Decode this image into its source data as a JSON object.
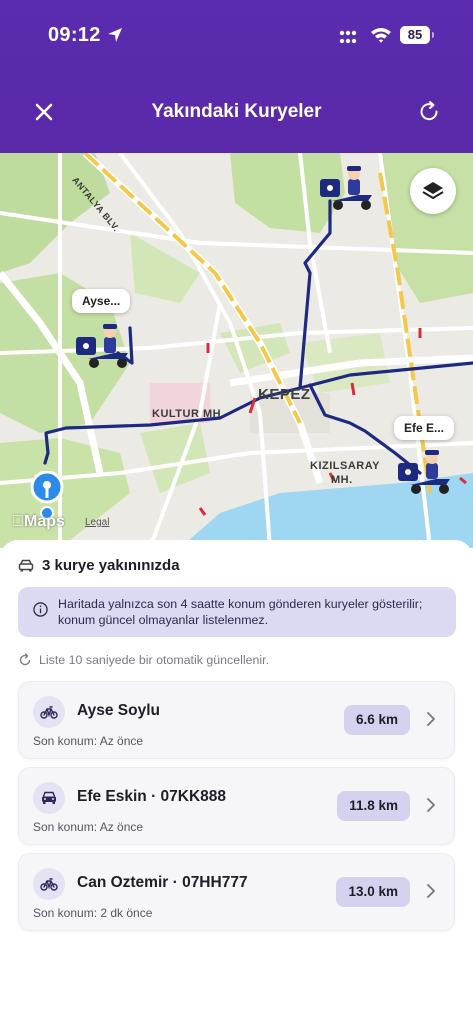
{
  "status_bar": {
    "time": "09:12",
    "battery": "85"
  },
  "header": {
    "title": "Yakındaki Kuryeler"
  },
  "map": {
    "labels": {
      "kepez": "KEPEZ",
      "kultur": "KULTUR MH.",
      "kizilsaray_1": "KIZILSARAY",
      "kizilsaray_2": "MH.",
      "antalya_blv": "ANTALYA BLV."
    },
    "bubbles": {
      "ayse": "Ayse...",
      "efe": "Efe E..."
    },
    "maps_logo": "Maps",
    "legal": "Legal"
  },
  "sheet": {
    "nearby_title": "3 kurye yakınınızda",
    "info": "Haritada yalnızca son 4 saatte konum gönderen kuryeler gösterilir; konum güncel olmayanlar listelenmez.",
    "auto_update": "Liste 10 saniyede bir otomatik güncellenir.",
    "couriers": [
      {
        "name": "Ayse Soylu",
        "vehicle": "bicycle-icon",
        "status": "Son konum: Az önce",
        "distance": "6.6 km"
      },
      {
        "name": "Efe Eskin · 07KK888",
        "vehicle": "car-icon",
        "status": "Son konum: Az önce",
        "distance": "11.8 km"
      },
      {
        "name": "Can Oztemir · 07HH777",
        "vehicle": "bicycle-icon",
        "status": "Son konum: 2 dk önce",
        "distance": "13.0 km"
      }
    ]
  },
  "colors": {
    "header": "#5a2aa9",
    "route": "#1e2a80",
    "pill": "#d4d2ef",
    "info_bg": "#dcd9f3"
  }
}
